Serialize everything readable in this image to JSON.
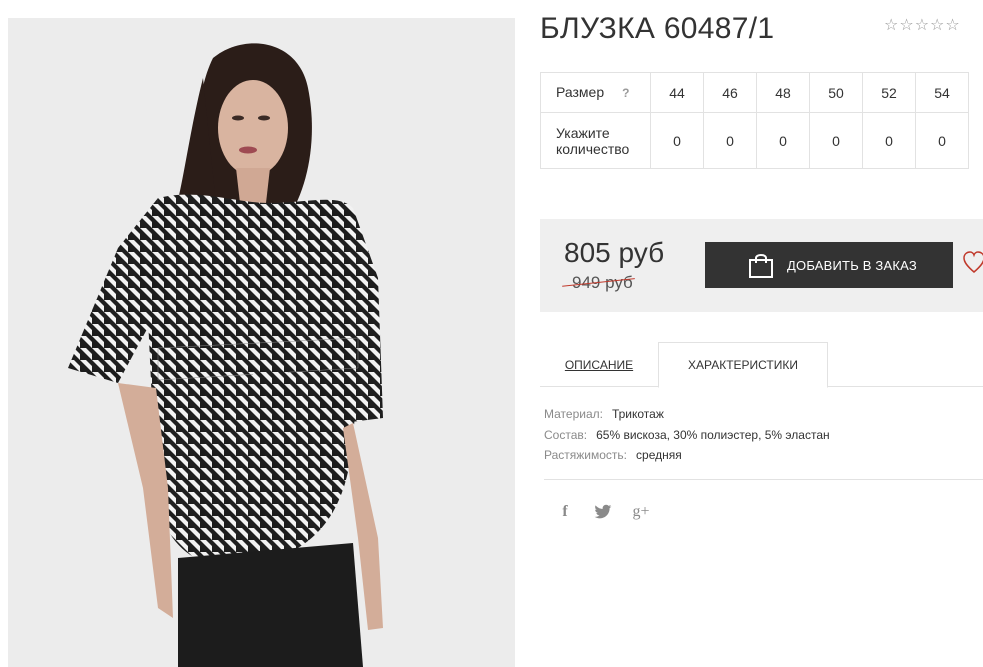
{
  "product": {
    "title": "БЛУЗКА 60487/1",
    "rating_stars": 5,
    "rating_value": 0
  },
  "sizes": {
    "size_label": "Размер",
    "help": "?",
    "qty_label": "Укажите количество",
    "values": [
      "44",
      "46",
      "48",
      "50",
      "52",
      "54"
    ],
    "quantities": [
      "0",
      "0",
      "0",
      "0",
      "0",
      "0"
    ]
  },
  "pricing": {
    "price": "805 руб",
    "old_price": "949 руб",
    "buy_label": "ДОБАВИТЬ В ЗАКАЗ"
  },
  "tabs": {
    "description": "ОПИСАНИЕ",
    "characteristics": "ХАРАКТЕРИСТИКИ"
  },
  "characteristics": [
    {
      "key": "Материал:",
      "value": "Трикотаж"
    },
    {
      "key": "Состав:",
      "value": "65% вискоза, 30% полиэстер, 5% эластан"
    },
    {
      "key": "Растяжимость:",
      "value": "средняя"
    }
  ],
  "social": {
    "facebook": "f",
    "twitter": "twitter-icon",
    "googleplus": "g+"
  },
  "colors": {
    "button": "#333333",
    "price_panel": "#efefef",
    "heart": "#c0392b"
  }
}
